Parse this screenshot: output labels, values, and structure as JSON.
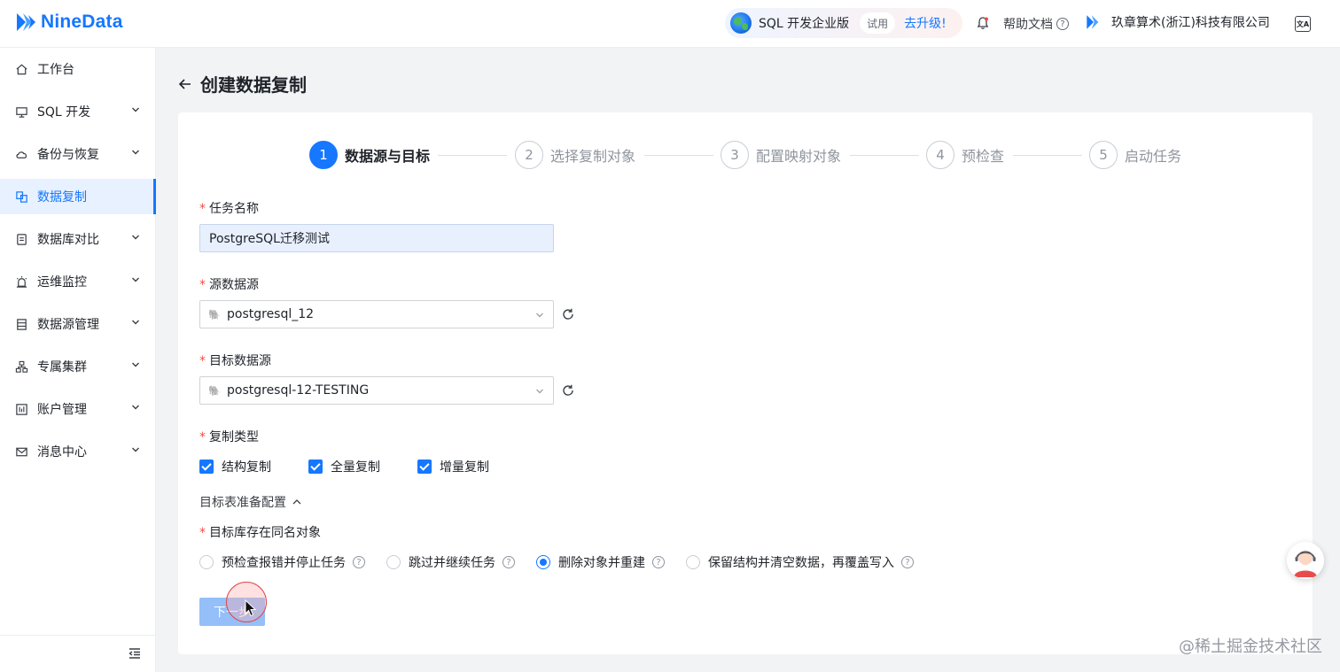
{
  "header": {
    "brand": "NineData",
    "edition": "SQL 开发企业版",
    "trial": "试用",
    "upgrade": "去升级!",
    "help": "帮助文档",
    "org": "玖章算术(浙江)科技有限公司",
    "lang_icon": "translate-icon"
  },
  "sidebar": {
    "items": [
      {
        "label": "工作台",
        "icon": "home-icon",
        "expandable": false
      },
      {
        "label": "SQL 开发",
        "icon": "monitor-icon",
        "expandable": true
      },
      {
        "label": "备份与恢复",
        "icon": "cloud-backup-icon",
        "expandable": true
      },
      {
        "label": "数据复制",
        "icon": "replicate-icon",
        "expandable": false,
        "active": true
      },
      {
        "label": "数据库对比",
        "icon": "compare-icon",
        "expandable": true
      },
      {
        "label": "运维监控",
        "icon": "alarm-icon",
        "expandable": true
      },
      {
        "label": "数据源管理",
        "icon": "datasource-icon",
        "expandable": true
      },
      {
        "label": "专属集群",
        "icon": "cluster-icon",
        "expandable": true
      },
      {
        "label": "账户管理",
        "icon": "account-icon",
        "expandable": true
      },
      {
        "label": "消息中心",
        "icon": "mail-icon",
        "expandable": true
      }
    ]
  },
  "page": {
    "title": "创建数据复制"
  },
  "steps": [
    {
      "num": "1",
      "label": "数据源与目标",
      "active": true
    },
    {
      "num": "2",
      "label": "选择复制对象"
    },
    {
      "num": "3",
      "label": "配置映射对象"
    },
    {
      "num": "4",
      "label": "预检查"
    },
    {
      "num": "5",
      "label": "启动任务"
    }
  ],
  "form": {
    "task_name": {
      "label": "任务名称",
      "value": "PostgreSQL迁移测试"
    },
    "source": {
      "label": "源数据源",
      "value": "postgresql_12"
    },
    "target": {
      "label": "目标数据源",
      "value": "postgresql-12-TESTING"
    },
    "copy_type": {
      "label": "复制类型",
      "options": [
        "结构复制",
        "全量复制",
        "增量复制"
      ],
      "checked": [
        true,
        true,
        true
      ]
    },
    "prep_toggle": "目标表准备配置",
    "conflict": {
      "label": "目标库存在同名对象",
      "options": [
        "预检查报错并停止任务",
        "跳过并继续任务",
        "删除对象并重建",
        "保留结构并清空数据，再覆盖写入"
      ],
      "selected": 2
    },
    "next": "下一步"
  },
  "colors": {
    "accent": "#1677ff",
    "required": "#f54a45"
  },
  "watermark": "@稀土掘金技术社区"
}
